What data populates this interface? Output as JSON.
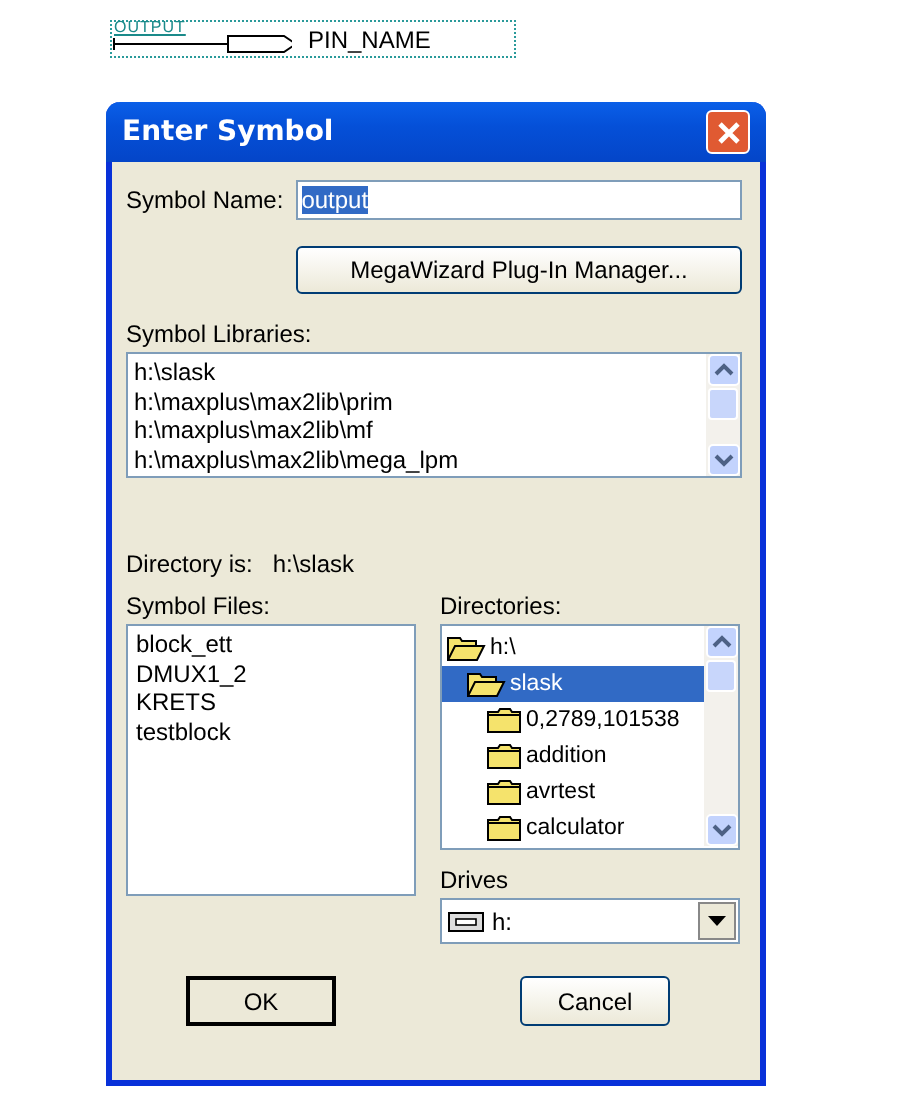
{
  "schematic": {
    "port_label": "OUTPUT",
    "pin_name": "PIN_NAME"
  },
  "window": {
    "title": "Enter Symbol"
  },
  "symbol_name": {
    "label": "Symbol Name:",
    "value": "output",
    "selected": true
  },
  "wizard_button": {
    "label": "MegaWizard Plug-In Manager..."
  },
  "libraries": {
    "label": "Symbol Libraries:",
    "items": [
      {
        "name": "h:\\slask",
        "selected": false
      },
      {
        "name": "h:\\maxplus\\max2lib\\prim",
        "selected": false
      },
      {
        "name": "h:\\maxplus\\max2lib\\mf",
        "selected": false
      },
      {
        "name": "h:\\maxplus\\max2lib\\mega_lpm",
        "selected": false
      }
    ]
  },
  "directory": {
    "label": "Directory is:",
    "path": "h:\\slask"
  },
  "files": {
    "label": "Symbol Files:",
    "items": [
      {
        "name": "block_ett",
        "selected": false
      },
      {
        "name": "DMUX1_2",
        "selected": false
      },
      {
        "name": "KRETS",
        "selected": false
      },
      {
        "name": "testblock",
        "selected": false
      }
    ]
  },
  "directories": {
    "label": "Directories:",
    "items": [
      {
        "name": "h:\\",
        "kind": "open",
        "selected": false,
        "children": [
          {
            "name": "slask",
            "kind": "open",
            "selected": true,
            "children": [
              {
                "name": "0,2789,101538",
                "kind": "closed",
                "selected": false
              },
              {
                "name": "addition",
                "kind": "closed",
                "selected": false
              },
              {
                "name": "avrtest",
                "kind": "closed",
                "selected": false
              },
              {
                "name": "calculator",
                "kind": "closed",
                "selected": false
              }
            ]
          }
        ]
      }
    ]
  },
  "drives": {
    "label": "Drives",
    "value": "h:"
  },
  "buttons": [
    {
      "label": "OK",
      "default": true
    },
    {
      "label": "Cancel",
      "default": false
    }
  ]
}
